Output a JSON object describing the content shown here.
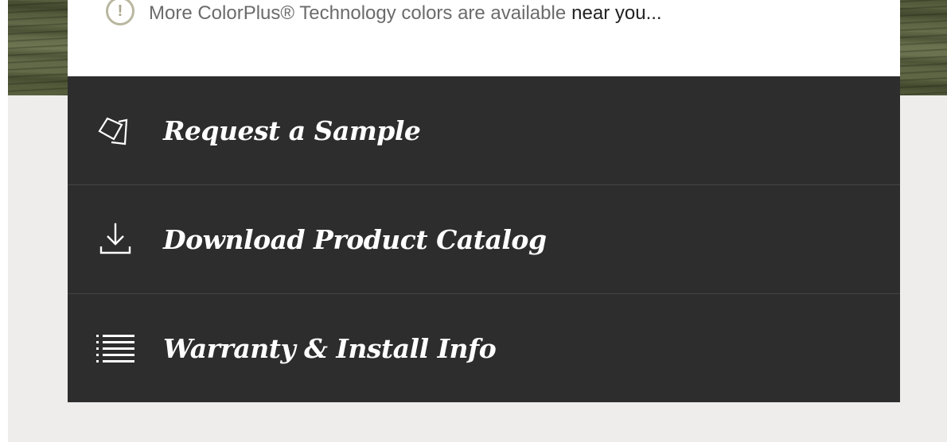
{
  "notice": {
    "icon": "info-icon",
    "icon_glyph": "!",
    "text": "More ColorPlus® Technology colors are available",
    "link": "near you..."
  },
  "menu": {
    "items": [
      {
        "label": "Request a Sample",
        "icon": "sample-swatch-icon"
      },
      {
        "label": "Download Product Catalog",
        "icon": "download-icon"
      },
      {
        "label": "Warranty & Install Info",
        "icon": "list-icon"
      }
    ]
  },
  "colors": {
    "menu_background": "#2d2d2d",
    "menu_text": "#ffffff",
    "page_background": "#eeedeb",
    "wood_green": "#5c6340"
  }
}
